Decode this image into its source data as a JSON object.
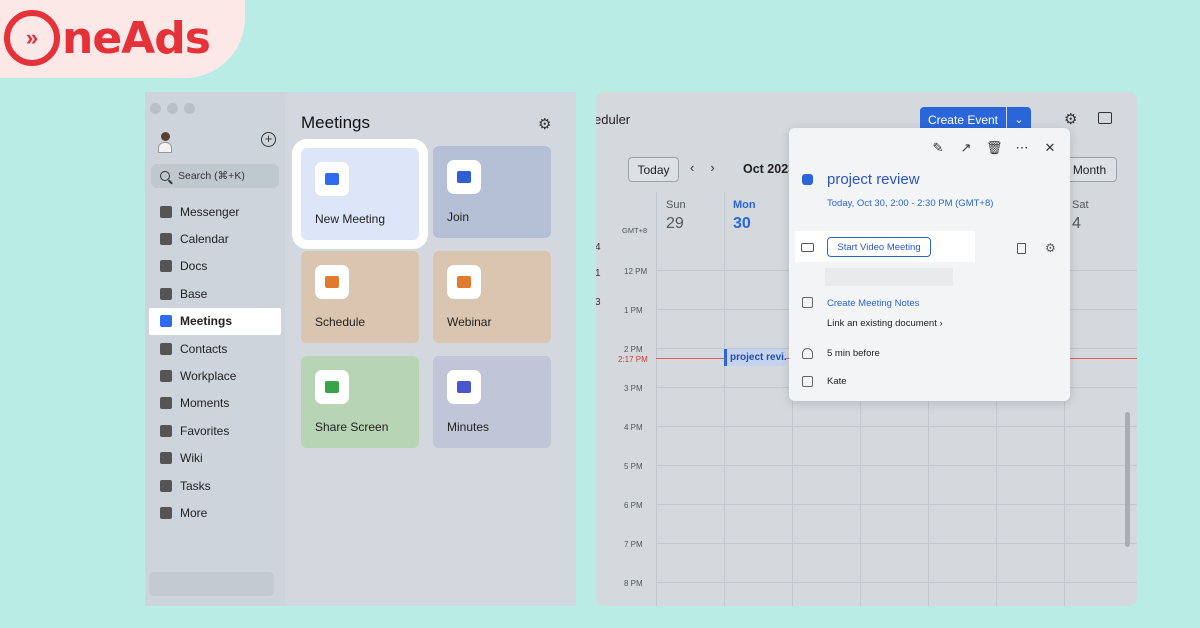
{
  "logo": {
    "mark": "»",
    "text": "neAds",
    "color": "#e53138"
  },
  "sidebar": {
    "search_placeholder": "Search (⌘+K)",
    "items": [
      {
        "label": "Messenger",
        "icon": "messenger-icon"
      },
      {
        "label": "Calendar",
        "icon": "calendar-icon"
      },
      {
        "label": "Docs",
        "icon": "docs-icon"
      },
      {
        "label": "Base",
        "icon": "base-icon"
      },
      {
        "label": "Meetings",
        "icon": "meetings-icon",
        "active": true
      },
      {
        "label": "Contacts",
        "icon": "contacts-icon"
      },
      {
        "label": "Workplace",
        "icon": "workplace-icon"
      },
      {
        "label": "Moments",
        "icon": "moments-icon"
      },
      {
        "label": "Favorites",
        "icon": "star-icon"
      },
      {
        "label": "Wiki",
        "icon": "wiki-icon"
      },
      {
        "label": "Tasks",
        "icon": "check-icon"
      },
      {
        "label": "More",
        "icon": "grid-icon"
      }
    ]
  },
  "meetings": {
    "title": "Meetings",
    "tiles": {
      "new": "New Meeting",
      "join": "Join",
      "schedule": "Schedule",
      "webinar": "Webinar",
      "share": "Share Screen",
      "minutes": "Minutes"
    }
  },
  "scheduler": {
    "title": "eduler",
    "create_label": "Create Event",
    "today_label": "Today",
    "month_label": "Oct 2023",
    "view_label": "Month",
    "timezone": "GMT+8",
    "days": [
      {
        "name": "Sun",
        "num": "29"
      },
      {
        "name": "Mon",
        "num": "30"
      },
      {
        "name": "Sat",
        "num": "4"
      }
    ],
    "edge_nums": [
      "4",
      "1",
      "3"
    ],
    "times": [
      "12 PM",
      "1 PM",
      "2 PM",
      "3 PM",
      "4 PM",
      "5 PM",
      "6 PM",
      "7 PM",
      "8 PM"
    ],
    "now_label": "2:17 PM",
    "event_label": "project revi..."
  },
  "popup": {
    "title": "project review",
    "time": "Today, Oct 30, 2:00 - 2:30 PM (GMT+8)",
    "video_button": "Start Video Meeting",
    "notes_link": "Create Meeting Notes",
    "link_doc": "Link an existing document",
    "reminder": "5 min before",
    "organizer": "Kate",
    "accent": "#2a66d9"
  }
}
